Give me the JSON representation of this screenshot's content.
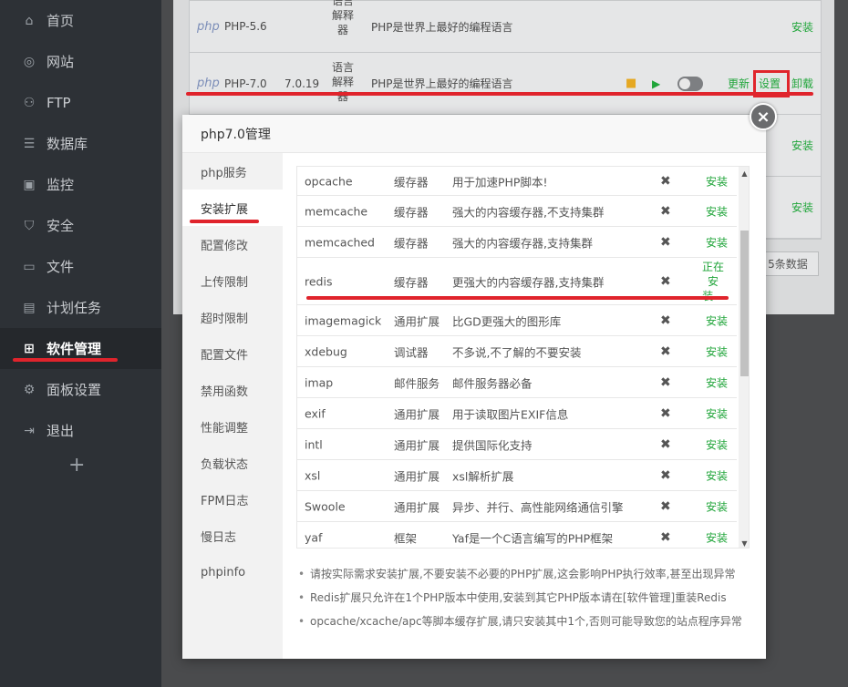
{
  "sidebar": {
    "items": [
      {
        "label": "首页",
        "icon": "home-icon"
      },
      {
        "label": "网站",
        "icon": "globe-icon"
      },
      {
        "label": "FTP",
        "icon": "ftp-icon"
      },
      {
        "label": "数据库",
        "icon": "database-icon"
      },
      {
        "label": "监控",
        "icon": "monitor-icon"
      },
      {
        "label": "安全",
        "icon": "shield-icon"
      },
      {
        "label": "文件",
        "icon": "folder-icon"
      },
      {
        "label": "计划任务",
        "icon": "calendar-icon"
      },
      {
        "label": "软件管理",
        "icon": "grid-icon",
        "active": true
      },
      {
        "label": "面板设置",
        "icon": "gear-icon"
      },
      {
        "label": "退出",
        "icon": "logout-icon"
      }
    ],
    "add_label": "+"
  },
  "software_rows": [
    {
      "logo": "php",
      "name": "PHP-5.6",
      "version": "",
      "type": "语言解释器",
      "desc": "PHP是世界上最好的编程语言",
      "action": "安装"
    },
    {
      "logo": "php",
      "name": "PHP-7.0",
      "version": "7.0.19",
      "type": "语言解释器",
      "desc": "PHP是世界上最好的编程语言",
      "update": "更新",
      "settings": "设置",
      "uninstall": "卸载"
    }
  ],
  "hidden_row_actions": [
    "安装",
    "安装"
  ],
  "pager_text": "5条数据",
  "modal": {
    "title": "php7.0管理",
    "close": "×",
    "side_items": [
      "php服务",
      "安装扩展",
      "配置修改",
      "上传限制",
      "超时限制",
      "配置文件",
      "禁用函数",
      "性能调整",
      "负载状态",
      "FPM日志",
      "慢日志",
      "phpinfo"
    ],
    "active_side": 1,
    "extensions": [
      {
        "name": "opcache",
        "type": "缓存器",
        "desc": "用于加速PHP脚本!",
        "x": "✖",
        "action": "安装"
      },
      {
        "name": "memcache",
        "type": "缓存器",
        "desc": "强大的内容缓存器,不支持集群",
        "x": "✖",
        "action": "安装"
      },
      {
        "name": "memcached",
        "type": "缓存器",
        "desc": "强大的内容缓存器,支持集群",
        "x": "✖",
        "action": "安装"
      },
      {
        "name": "redis",
        "type": "缓存器",
        "desc": "更强大的内容缓存器,支持集群",
        "x": "✖",
        "action": "正在安装..."
      },
      {
        "name": "imagemagick",
        "type": "通用扩展",
        "desc": "比GD更强大的图形库",
        "x": "✖",
        "action": "安装"
      },
      {
        "name": "xdebug",
        "type": "调试器",
        "desc": "不多说,不了解的不要安装",
        "x": "✖",
        "action": "安装"
      },
      {
        "name": "imap",
        "type": "邮件服务",
        "desc": "邮件服务器必备",
        "x": "✖",
        "action": "安装"
      },
      {
        "name": "exif",
        "type": "通用扩展",
        "desc": "用于读取图片EXIF信息",
        "x": "✖",
        "action": "安装"
      },
      {
        "name": "intl",
        "type": "通用扩展",
        "desc": "提供国际化支持",
        "x": "✖",
        "action": "安装"
      },
      {
        "name": "xsl",
        "type": "通用扩展",
        "desc": "xsl解析扩展",
        "x": "✖",
        "action": "安装"
      },
      {
        "name": "Swoole",
        "type": "通用扩展",
        "desc": "异步、并行、高性能网络通信引擎",
        "x": "✖",
        "action": "安装"
      },
      {
        "name": "yaf",
        "type": "框架",
        "desc": "Yaf是一个C语言编写的PHP框架",
        "x": "✖",
        "action": "安装"
      }
    ],
    "tips": [
      "请按实际需求安装扩展,不要安装不必要的PHP扩展,这会影响PHP执行效率,甚至出现异常",
      "Redis扩展只允许在1个PHP版本中使用,安装到其它PHP版本请在[软件管理]重装Redis",
      "opcache/xcache/apc等脚本缓存扩展,请只安装其中1个,否则可能导致您的站点程序异常"
    ]
  },
  "colors": {
    "accent_green": "#20a53a",
    "annotation_red": "#e0242c",
    "sidebar_bg": "#2d3136"
  }
}
